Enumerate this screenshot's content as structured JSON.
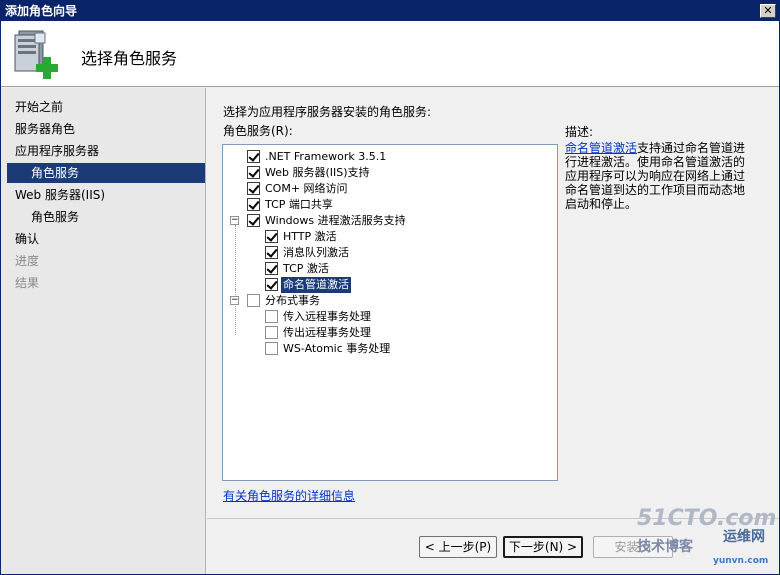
{
  "window": {
    "title": "添加角色向导",
    "close_glyph": "✕"
  },
  "header": {
    "title": "选择角色服务",
    "icon": "server-add-icon"
  },
  "sidebar": {
    "items": [
      {
        "label": "开始之前",
        "state": "normal",
        "level": 0
      },
      {
        "label": "服务器角色",
        "state": "normal",
        "level": 0
      },
      {
        "label": "应用程序服务器",
        "state": "normal",
        "level": 0
      },
      {
        "label": "角色服务",
        "state": "active",
        "level": 1
      },
      {
        "label": "Web 服务器(IIS)",
        "state": "normal",
        "level": 0
      },
      {
        "label": "角色服务",
        "state": "normal",
        "level": 1
      },
      {
        "label": "确认",
        "state": "normal",
        "level": 0
      },
      {
        "label": "进度",
        "state": "disabled",
        "level": 0
      },
      {
        "label": "结果",
        "state": "disabled",
        "level": 0
      }
    ]
  },
  "main": {
    "instruction": "选择为应用程序服务器安装的角色服务:",
    "list_label": "角色服务(R):",
    "tree": [
      {
        "label": ".NET Framework 3.5.1",
        "checked": true,
        "level": 0,
        "expander": ""
      },
      {
        "label": "Web 服务器(IIS)支持",
        "checked": true,
        "level": 0,
        "expander": ""
      },
      {
        "label": "COM+ 网络访问",
        "checked": true,
        "level": 0,
        "expander": ""
      },
      {
        "label": "TCP 端口共享",
        "checked": true,
        "level": 0,
        "expander": ""
      },
      {
        "label": "Windows 进程激活服务支持",
        "checked": true,
        "level": 0,
        "expander": "−"
      },
      {
        "label": "HTTP 激活",
        "checked": true,
        "level": 1,
        "expander": ""
      },
      {
        "label": "消息队列激活",
        "checked": true,
        "level": 1,
        "expander": ""
      },
      {
        "label": "TCP 激活",
        "checked": true,
        "level": 1,
        "expander": ""
      },
      {
        "label": "命名管道激活",
        "checked": true,
        "level": 1,
        "expander": "",
        "selected": true
      },
      {
        "label": "分布式事务",
        "checked": false,
        "level": 0,
        "expander": "−"
      },
      {
        "label": "传入远程事务处理",
        "checked": false,
        "level": 1,
        "expander": ""
      },
      {
        "label": "传出远程事务处理",
        "checked": false,
        "level": 1,
        "expander": ""
      },
      {
        "label": "WS-Atomic 事务处理",
        "checked": false,
        "level": 1,
        "expander": ""
      }
    ],
    "more_info_link": "有关角色服务的详细信息"
  },
  "description": {
    "title": "描述:",
    "link": "命名管道激活",
    "text": "支持通过命名管道进行进程激活。使用命名管道激活的应用程序可以为响应在网络上通过命名管道到达的工作项目而动态地启动和停止。"
  },
  "footer": {
    "back": "< 上一步(P)",
    "next": "下一步(N) >",
    "install": "安装(I)"
  },
  "watermark": {
    "big": "51CTO.com",
    "small": "技术博客",
    "right": "运维网",
    "url": "yunvn.com"
  }
}
